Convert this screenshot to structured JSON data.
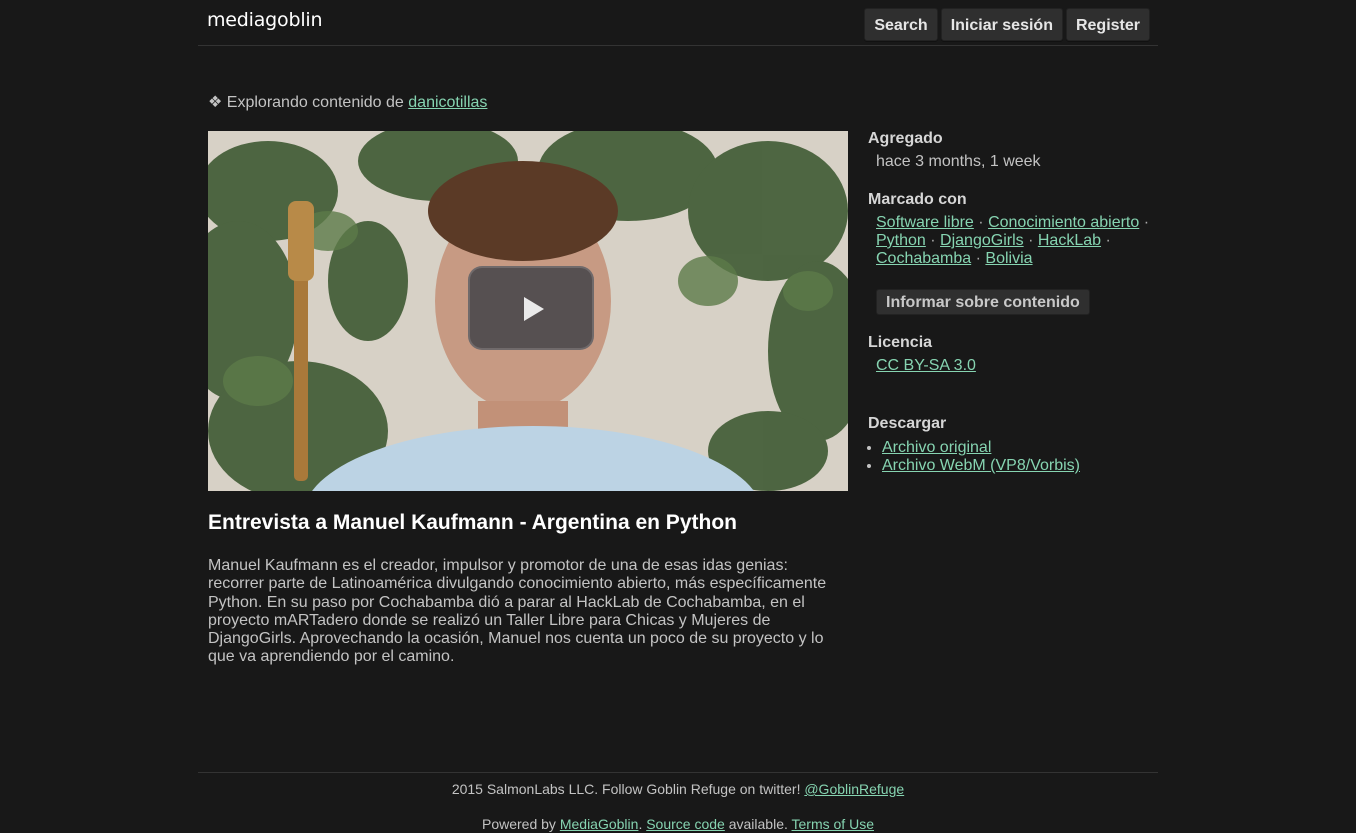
{
  "header": {
    "logo": "mediagoblin",
    "search_label": "Search",
    "login_label": "Iniciar sesión",
    "register_label": "Register"
  },
  "explore": {
    "prefix": "❖ Explorando contenido de ",
    "user": "danicotillas"
  },
  "media": {
    "title": "Entrevista a Manuel Kaufmann - Argentina en Python",
    "description": "Manuel Kaufmann es el creador, impulsor y promotor de una de esas idas genias: recorrer parte de Latinoamérica divulgando conocimiento abierto, más específicamente Python. En su paso por Cochabamba dió a parar al HackLab de Cochabamba, en el proyecto mARTadero donde se realizó un Taller Libre para Chicas y Mujeres de DjangoGirls. Aprovechando la ocasión, Manuel nos cuenta un poco de su proyecto y lo que va aprendiendo por el camino."
  },
  "sidebar": {
    "added_label": "Agregado",
    "added_value": "hace 3 months, 1 week",
    "tags_label": "Marcado con",
    "tags": [
      "Software libre",
      "Conocimiento abierto",
      "Python",
      "DjangoGirls",
      "HackLab",
      "Cochabamba",
      "Bolivia"
    ],
    "tag_separator": "·",
    "report_label": "Informar sobre contenido",
    "license_label": "Licencia",
    "license_value": "CC BY-SA 3.0",
    "download_label": "Descargar",
    "downloads": [
      "Archivo original",
      "Archivo WebM (VP8/Vorbis)"
    ]
  },
  "footer": {
    "line1_text": "2015 SalmonLabs LLC. Follow Goblin Refuge on twitter! ",
    "line1_link": "@GoblinRefuge",
    "powered_prefix": "Powered by ",
    "mediagoblin_link": "MediaGoblin",
    "period_space": ". ",
    "source_link": "Source code",
    "available_text": " available. ",
    "terms_link": "Terms of Use"
  }
}
